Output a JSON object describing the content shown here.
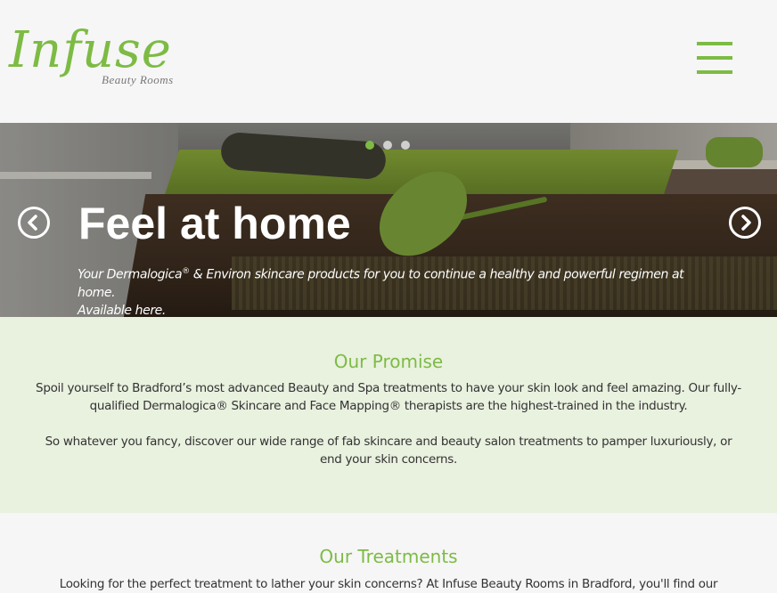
{
  "header": {
    "logo_main": "Infuse",
    "logo_sub": "Beauty Rooms",
    "menu_label": ""
  },
  "slider": {
    "title": "Feel at home",
    "text_line1_a": "Your Dermalogica",
    "text_reg1": "®",
    "text_line1_b": " & Environ skincare products for you to continue a healthy and powerful regimen at home.",
    "text_line2": "Available here.",
    "dots": 3,
    "active_dot": 1
  },
  "promise": {
    "title": "Our Promise",
    "p1": "Spoil yourself to Bradford’s most advanced Beauty and Spa treatments to have your skin look and feel amazing. Our fully-qualified Dermalogica® Skincare and Face Mapping® therapists are the highest-trained in the industry.",
    "p2": "So whatever you fancy, discover our wide range of fab skincare and beauty salon treatments to pamper luxuriously, or end your skin concerns."
  },
  "treatments": {
    "title": "Our Treatments",
    "p1": "Looking for the perfect treatment to lather your skin concerns? At Infuse Beauty Rooms in Bradford, you'll find our"
  },
  "colors": {
    "accent": "#7dbb44",
    "promise_bg": "#e9f1df",
    "page_bg": "#f6f6f6"
  },
  "icons": {
    "menu": "hamburger-icon",
    "prev": "chevron-left-circle-icon",
    "next": "chevron-right-circle-icon"
  }
}
